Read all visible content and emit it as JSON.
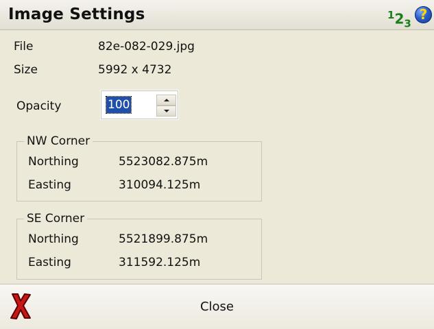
{
  "window": {
    "title": "Image Settings",
    "header_icon_numeric": "numeric-123-icon",
    "header_icon_help": "help-icon"
  },
  "details": {
    "file_label": "File",
    "file_value": "82e-082-029.jpg",
    "size_label": "Size",
    "size_value": "5992 x 4732",
    "opacity_label": "Opacity",
    "opacity_value": "100"
  },
  "nw_corner": {
    "title": "NW Corner",
    "northing_label": "Northing",
    "northing_value": "5523082.875m",
    "easting_label": "Easting",
    "easting_value": "310094.125m"
  },
  "se_corner": {
    "title": "SE Corner",
    "northing_label": "Northing",
    "northing_value": "5521899.875m",
    "easting_label": "Easting",
    "easting_value": "311592.125m"
  },
  "footer": {
    "close_label": "Close",
    "close_icon": "close-icon"
  },
  "colors": {
    "background": "#ece9d8",
    "selection": "#1f4fa8",
    "help_blue": "#2a5cc7",
    "help_yellow": "#ffd800",
    "numeric_green": "#1b7d1b",
    "close_red": "#c61616"
  }
}
